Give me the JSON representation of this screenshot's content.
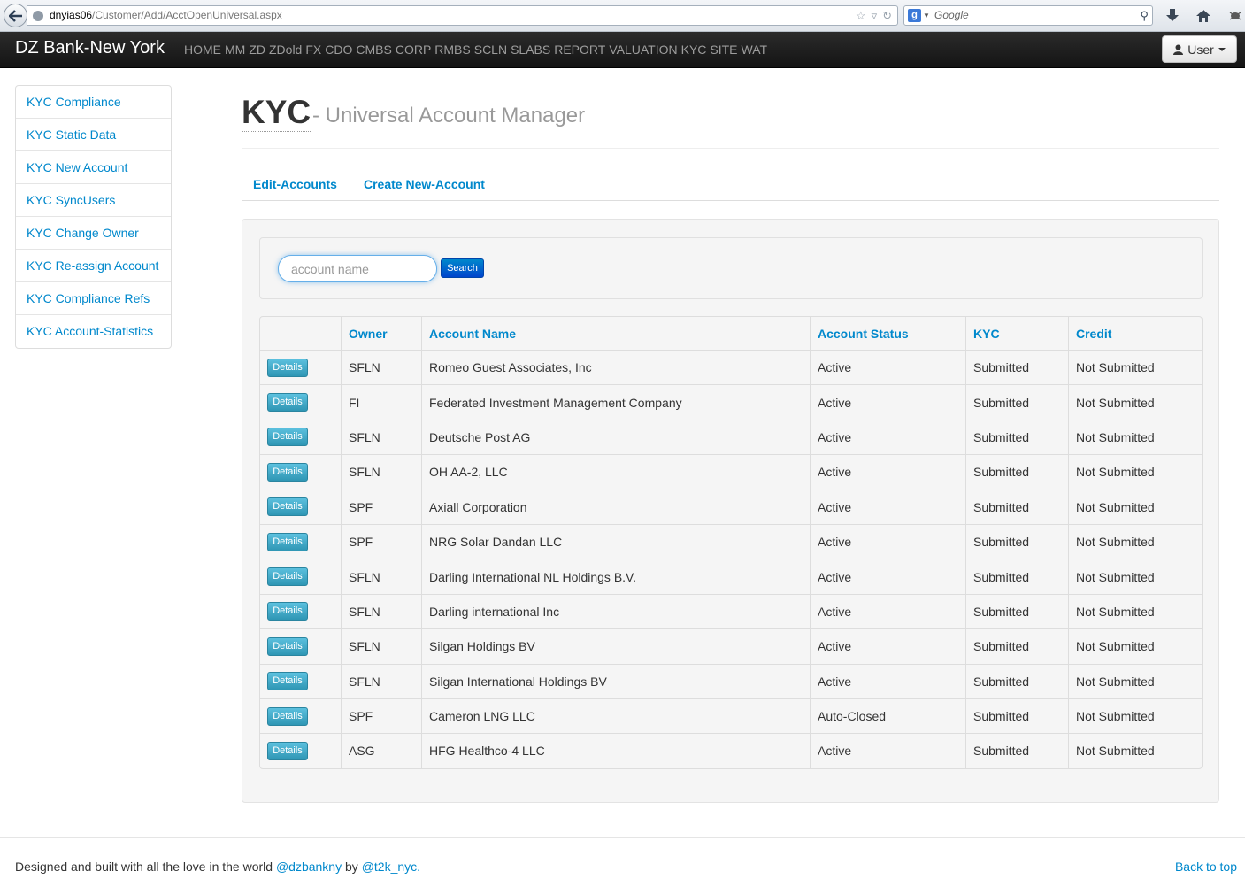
{
  "browser": {
    "url_host": "dnyias06",
    "url_path": "/Customer/Add/AcctOpenUniversal.aspx",
    "search_placeholder": "Google"
  },
  "navbar": {
    "brand": "DZ Bank-New York",
    "links": [
      "HOME",
      "MM",
      "ZD",
      "ZDold",
      "FX",
      "CDO",
      "CMBS",
      "CORP",
      "RMBS",
      "SCLN",
      "SLABS",
      "REPORT",
      "VALUATION",
      "KYC",
      "SITE",
      "WAT"
    ],
    "user_label": "User"
  },
  "sidebar": {
    "items": [
      {
        "label": "KYC Compliance"
      },
      {
        "label": "KYC Static Data"
      },
      {
        "label": "KYC New Account"
      },
      {
        "label": "KYC SyncUsers"
      },
      {
        "label": "KYC Change Owner"
      },
      {
        "label": "KYC Re-assign Account"
      },
      {
        "label": "KYC Compliance Refs"
      },
      {
        "label": "KYC Account-Statistics"
      }
    ]
  },
  "header": {
    "title": "KYC",
    "subtitle": "- Universal Account Manager"
  },
  "tabs": [
    {
      "label": "Edit-Accounts"
    },
    {
      "label": "Create New-Account"
    }
  ],
  "search": {
    "placeholder": "account name",
    "value": "",
    "button_label": "Search"
  },
  "table": {
    "columns": [
      "",
      "Owner",
      "Account Name",
      "Account Status",
      "KYC",
      "Credit"
    ],
    "details_label": "Details",
    "rows": [
      {
        "owner": "SFLN",
        "account_name": "Romeo Guest Associates, Inc",
        "status": "Active",
        "kyc": "Submitted",
        "credit": "Not Submitted"
      },
      {
        "owner": "FI",
        "account_name": "Federated Investment Management Company",
        "status": "Active",
        "kyc": "Submitted",
        "credit": "Not Submitted"
      },
      {
        "owner": "SFLN",
        "account_name": "Deutsche Post AG",
        "status": "Active",
        "kyc": "Submitted",
        "credit": "Not Submitted"
      },
      {
        "owner": "SFLN",
        "account_name": "OH AA-2, LLC",
        "status": "Active",
        "kyc": "Submitted",
        "credit": "Not Submitted"
      },
      {
        "owner": "SPF",
        "account_name": "Axiall Corporation",
        "status": "Active",
        "kyc": "Submitted",
        "credit": "Not Submitted"
      },
      {
        "owner": "SPF",
        "account_name": "NRG Solar Dandan LLC",
        "status": "Active",
        "kyc": "Submitted",
        "credit": "Not Submitted"
      },
      {
        "owner": "SFLN",
        "account_name": "Darling International NL Holdings B.V.",
        "status": "Active",
        "kyc": "Submitted",
        "credit": "Not Submitted"
      },
      {
        "owner": "SFLN",
        "account_name": "Darling international Inc",
        "status": "Active",
        "kyc": "Submitted",
        "credit": "Not Submitted"
      },
      {
        "owner": "SFLN",
        "account_name": "Silgan Holdings BV",
        "status": "Active",
        "kyc": "Submitted",
        "credit": "Not Submitted"
      },
      {
        "owner": "SFLN",
        "account_name": "Silgan International Holdings BV",
        "status": "Active",
        "kyc": "Submitted",
        "credit": "Not Submitted"
      },
      {
        "owner": "SPF",
        "account_name": "Cameron LNG LLC",
        "status": "Auto-Closed",
        "kyc": "Submitted",
        "credit": "Not Submitted"
      },
      {
        "owner": "ASG",
        "account_name": "HFG Healthco-4 LLC",
        "status": "Active",
        "kyc": "Submitted",
        "credit": "Not Submitted"
      }
    ]
  },
  "footer": {
    "text_before": "Designed and built with all the love in the world",
    "link1": "@dzbankny",
    "text_mid": "by",
    "link2": "@t2k_nyc.",
    "back_to_top": "Back to top"
  },
  "colors": {
    "link": "#0088cc",
    "navbar": "#1b1b1b",
    "details_button": "#49afcd",
    "search_button": "#0066cc"
  }
}
